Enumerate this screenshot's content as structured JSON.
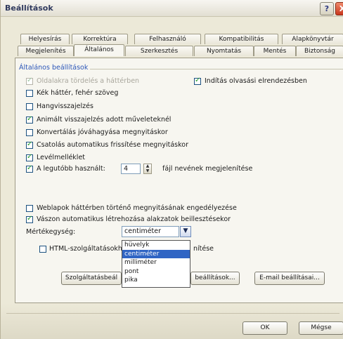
{
  "window": {
    "title": "Beállítások",
    "help_label": "?",
    "close_label": "X"
  },
  "tabs_row1": [
    "Helyesírás",
    "Korrektúra",
    "Felhasználó",
    "Kompatibilitás",
    "Alapkönyvtár"
  ],
  "tabs_row2": [
    "Megjelenítés",
    "Általános",
    "Szerkesztés",
    "Nyomtatás",
    "Mentés",
    "Biztonság"
  ],
  "active_tab": "Általános",
  "general_options": {
    "group_title": "Általános beállítások",
    "options": [
      {
        "label": "Oldalakra tördelés a háttérben",
        "checked": true,
        "disabled": true
      },
      {
        "label": "Kék háttér, fehér szöveg",
        "checked": false
      },
      {
        "label": "Hangvisszajelzés",
        "checked": false
      },
      {
        "label": "Animált visszajelzés adott műveleteknél",
        "checked": true
      },
      {
        "label": "Konvertálás jóváhagyása megnyitáskor",
        "checked": false
      },
      {
        "label": "Csatolás automatikus frissítése megnyitáskor",
        "checked": true
      },
      {
        "label": "Levélmelléklet",
        "checked": true
      }
    ],
    "reading_mode": {
      "label": "Indítás olvasási elrendezésben",
      "checked": true
    },
    "recent_files": {
      "label": "A legutóbb használt:",
      "value": "4",
      "suffix": "fájl nevének megjelenítése",
      "checked": true
    },
    "web_background": {
      "label": "Weblapok háttérben történő megnyitásának engedélyezése",
      "checked": false
    },
    "canvas_auto": {
      "label": "Vászon automatikus létrehozása alakzatok beillesztésekor",
      "checked": true
    },
    "measure": {
      "label": "Mértékegység:",
      "selected": "centiméter",
      "options": [
        "hüvelyk",
        "centiméter",
        "milliméter",
        "pont",
        "pika"
      ]
    },
    "html_pixels": {
      "label_left": "HTML-szolgáltatásokh",
      "label_right": "nítése",
      "checked": false
    }
  },
  "buttons": {
    "service": "Szolgáltatásbeál",
    "web": "beállítások...",
    "email": "E-mail beállításai...",
    "ok": "OK",
    "cancel": "Mégse"
  }
}
